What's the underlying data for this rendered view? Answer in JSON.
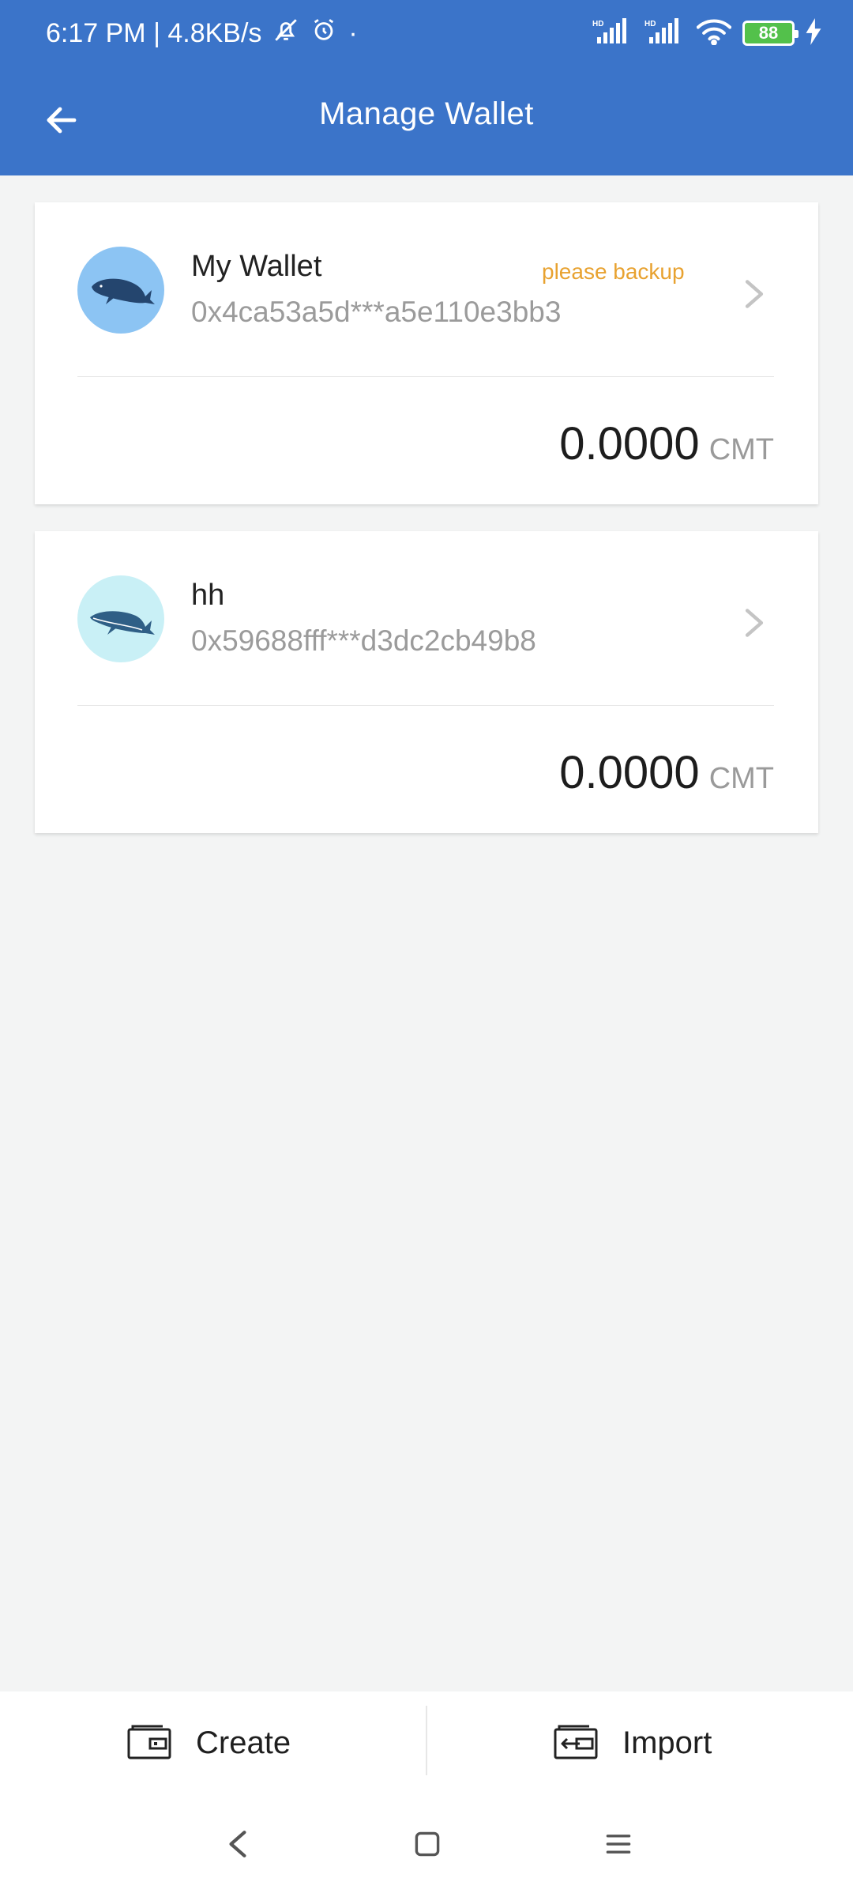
{
  "status_bar": {
    "time_speed": "6:17 PM | 4.8KB/s",
    "dot": "·",
    "battery": "88"
  },
  "header": {
    "title": "Manage Wallet"
  },
  "wallets": [
    {
      "name": "My Wallet",
      "address": "0x4ca53a5d***a5e110e3bb3",
      "backup_note": "please backup",
      "balance": "0.0000",
      "unit": "CMT"
    },
    {
      "name": "hh",
      "address": "0x59688fff***d3dc2cb49b8",
      "balance": "0.0000",
      "unit": "CMT"
    }
  ],
  "actions": {
    "create_label": "Create",
    "import_label": "Import"
  },
  "icons": {
    "back": "arrow-left-icon",
    "chevron": "chevron-right-icon",
    "create": "wallet-icon",
    "import": "import-icon"
  },
  "colors": {
    "header": "#3b74c9",
    "backup": "#e8a230",
    "background": "#f3f4f4"
  }
}
